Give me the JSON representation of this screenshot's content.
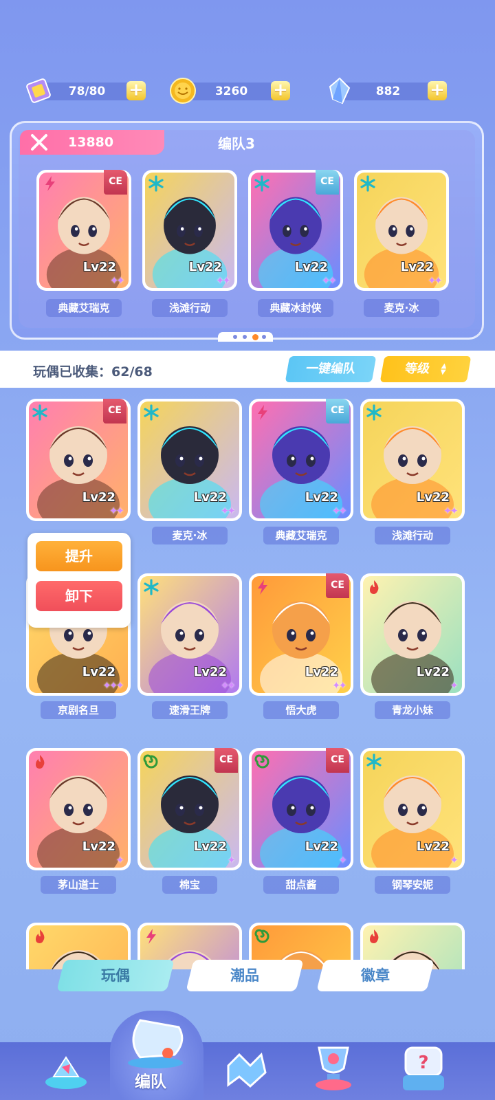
{
  "resources": {
    "tickets": {
      "value": "78/80",
      "icon": "ticket-icon"
    },
    "coins": {
      "value": "3260",
      "icon": "coin-icon"
    },
    "gems": {
      "value": "882",
      "icon": "crystal-icon"
    },
    "plus": "+"
  },
  "team": {
    "power": "13880",
    "title": "编队3",
    "members": [
      {
        "name": "典藏艾瑞克",
        "level": "Lv22",
        "element": "lightning",
        "ce": "CE"
      },
      {
        "name": "浅滩行动",
        "level": "Lv22",
        "element": "ice",
        "ce": ""
      },
      {
        "name": "典藏冰封侠",
        "level": "Lv22",
        "element": "ice",
        "ce": "CE"
      },
      {
        "name": "麦克·冰",
        "level": "Lv22",
        "element": "ice",
        "ce": ""
      }
    ],
    "page_dots": 4,
    "active_dot": 2
  },
  "collection": {
    "label": "玩偶已收集：62/68",
    "auto_team_label": "一键编队",
    "sort_label": "等级"
  },
  "grid": [
    {
      "name": "",
      "level": "Lv22",
      "element": "ice",
      "ce": "CE",
      "stars": "✦✦"
    },
    {
      "name": "麦克·冰",
      "level": "Lv22",
      "element": "ice",
      "ce": "",
      "stars": "✦✦"
    },
    {
      "name": "典藏艾瑞克",
      "level": "Lv22",
      "element": "lightning",
      "ce": "CE",
      "stars": "✦✦"
    },
    {
      "name": "浅滩行动",
      "level": "Lv22",
      "element": "ice",
      "ce": "",
      "stars": "✦✦"
    },
    {
      "name": "京剧名旦",
      "level": "Lv22",
      "element": "fire",
      "ce": "",
      "stars": "✦✦✦"
    },
    {
      "name": "速滑王牌",
      "level": "Lv22",
      "element": "ice",
      "ce": "",
      "stars": "✦✦"
    },
    {
      "name": "悟大虎",
      "level": "Lv22",
      "element": "lightning",
      "ce": "CE",
      "stars": "✦✦"
    },
    {
      "name": "青龙小妹",
      "level": "Lv22",
      "element": "fire",
      "ce": "",
      "stars": "✦"
    },
    {
      "name": "茅山道士",
      "level": "Lv22",
      "element": "fire",
      "ce": "",
      "stars": "✦"
    },
    {
      "name": "棉宝",
      "level": "Lv22",
      "element": "wind",
      "ce": "CE",
      "stars": "✦"
    },
    {
      "name": "甜点酱",
      "level": "Lv22",
      "element": "wind",
      "ce": "CE",
      "stars": "✦"
    },
    {
      "name": "钢琴安妮",
      "level": "Lv22",
      "element": "ice",
      "ce": "",
      "stars": "✦"
    },
    {
      "name": "",
      "level": "",
      "element": "fire",
      "ce": "",
      "stars": ""
    },
    {
      "name": "",
      "level": "",
      "element": "lightning",
      "ce": "",
      "stars": ""
    },
    {
      "name": "",
      "level": "",
      "element": "wind",
      "ce": "",
      "stars": ""
    },
    {
      "name": "",
      "level": "",
      "element": "fire",
      "ce": "",
      "stars": ""
    }
  ],
  "popup": {
    "upgrade": "提升",
    "unload": "卸下"
  },
  "tabs": [
    "玩偶",
    "潮品",
    "徽章"
  ],
  "nav": {
    "active_label": "编队",
    "items": [
      "home-icon",
      "whistle-icon",
      "puzzle-icon",
      "trophy-icon",
      "gacha-icon"
    ]
  },
  "colors": {
    "element_ice": "#1fb8c8",
    "element_fire": "#e8403a",
    "element_lightning": "#e8407a",
    "element_wind": "#2f9a3a",
    "star": "#d58cff"
  }
}
